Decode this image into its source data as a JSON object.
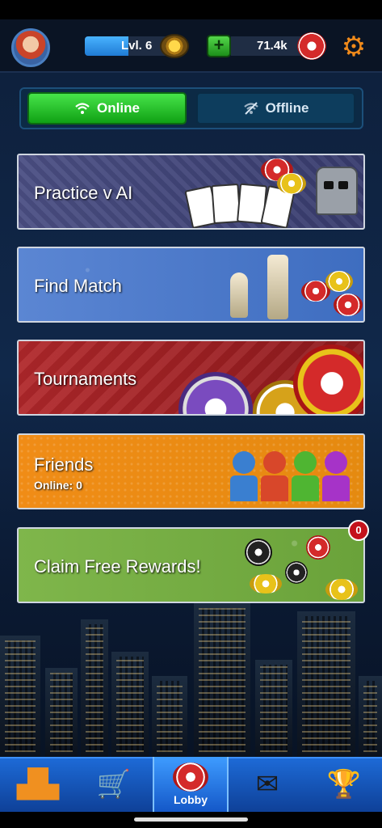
{
  "topbar": {
    "level_label": "Lvl. 6",
    "xp_progress": 0.45,
    "chips_value": "71.4k",
    "plus_label": "+"
  },
  "mode_toggle": {
    "online_label": "Online",
    "offline_label": "Offline",
    "selected": "Online"
  },
  "menu": {
    "practice": "Practice v AI",
    "find_match": "Find Match",
    "tournaments": "Tournaments",
    "friends": "Friends",
    "friends_online": "Online: 0",
    "claim_rewards": "Claim Free Rewards!",
    "rewards_badge": "0"
  },
  "bottom_nav": {
    "lobby_label": "Lobby",
    "items": [
      "leaderboard-icon",
      "shop-cart-icon",
      "lobby-chip-icon",
      "mail-icon",
      "trophy-icon"
    ],
    "selected": "Lobby"
  },
  "colors": {
    "online_green": "#2fcf33",
    "offline_blue": "#0d3d5d",
    "nav_blue": "#1d6ad6",
    "badge_red": "#c4121c"
  }
}
